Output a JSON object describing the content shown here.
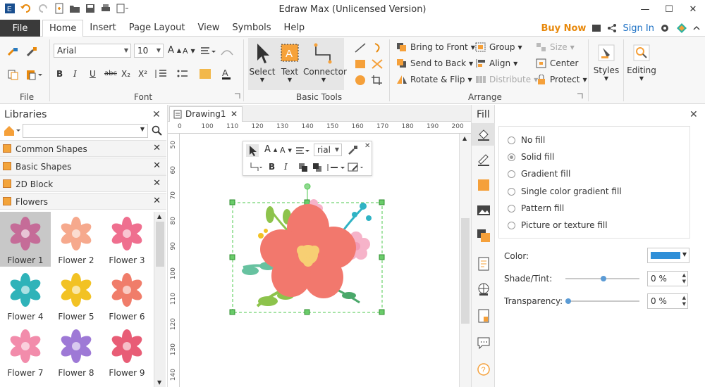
{
  "window": {
    "title": "Edraw Max (Unlicensed Version)"
  },
  "menu": {
    "file": "File",
    "tabs": [
      "Home",
      "Insert",
      "Page Layout",
      "View",
      "Symbols",
      "Help"
    ],
    "buy_now": "Buy Now",
    "sign_in": "Sign In"
  },
  "ribbon": {
    "groups": {
      "file": "File",
      "font": "Font",
      "basic_tools": "Basic Tools",
      "arrange": "Arrange"
    },
    "font_name": "Arial",
    "font_size": "10",
    "tools": {
      "select": "Select",
      "text": "Text",
      "connector": "Connector",
      "text_icon_letter": "A"
    },
    "arrange": {
      "bring_to_front": "Bring to Front",
      "send_to_back": "Send to Back",
      "rotate_flip": "Rotate & Flip",
      "group": "Group",
      "align": "Align",
      "distribute": "Distribute",
      "size": "Size",
      "center": "Center",
      "protect": "Protect"
    },
    "styles": "Styles",
    "editing": "Editing",
    "format_buttons": [
      "B",
      "I",
      "U",
      "abc",
      "X₂",
      "X²"
    ],
    "font_grow": "A",
    "font_shrink": "A"
  },
  "libraries": {
    "title": "Libraries",
    "search_value": "",
    "categories": [
      "Common Shapes",
      "Basic Shapes",
      "2D Block",
      "Flowers"
    ],
    "shapes": [
      {
        "label": "Flower 1",
        "color": "#c56c98"
      },
      {
        "label": "Flower 2",
        "color": "#f6a98d"
      },
      {
        "label": "Flower 3",
        "color": "#ef6f8f"
      },
      {
        "label": "Flower 4",
        "color": "#2fb3b9"
      },
      {
        "label": "Flower 5",
        "color": "#f2c224"
      },
      {
        "label": "Flower 6",
        "color": "#f07d6a"
      },
      {
        "label": "Flower 7",
        "color": "#f28cab"
      },
      {
        "label": "Flower 8",
        "color": "#9e79d6"
      },
      {
        "label": "Flower 9",
        "color": "#e85d76"
      }
    ]
  },
  "document": {
    "tab": "Drawing1",
    "ruler_top": [
      "0",
      "100",
      "110",
      "120",
      "130",
      "140",
      "150",
      "160",
      "170",
      "180",
      "190",
      "200"
    ],
    "ruler_left": [
      "50",
      "60",
      "70",
      "80",
      "90",
      "100",
      "110",
      "120",
      "130",
      "140"
    ],
    "float_font": "rial"
  },
  "fill_panel": {
    "title": "Fill",
    "options": [
      "No fill",
      "Solid fill",
      "Gradient fill",
      "Single color gradient fill",
      "Pattern fill",
      "Picture or texture fill"
    ],
    "selected": "Solid fill",
    "color_label": "Color:",
    "color_value": "#2f8fd8",
    "shade_label": "Shade/Tint:",
    "shade_value": "0 %",
    "shade_level": 0.5,
    "transparency_label": "Transparency:",
    "transparency_value": "0 %",
    "transparency_level": 0
  },
  "colors": {
    "accent_orange": "#f5a03a",
    "file_bg": "#3a3a3a",
    "link_blue": "#1a6fc4"
  }
}
